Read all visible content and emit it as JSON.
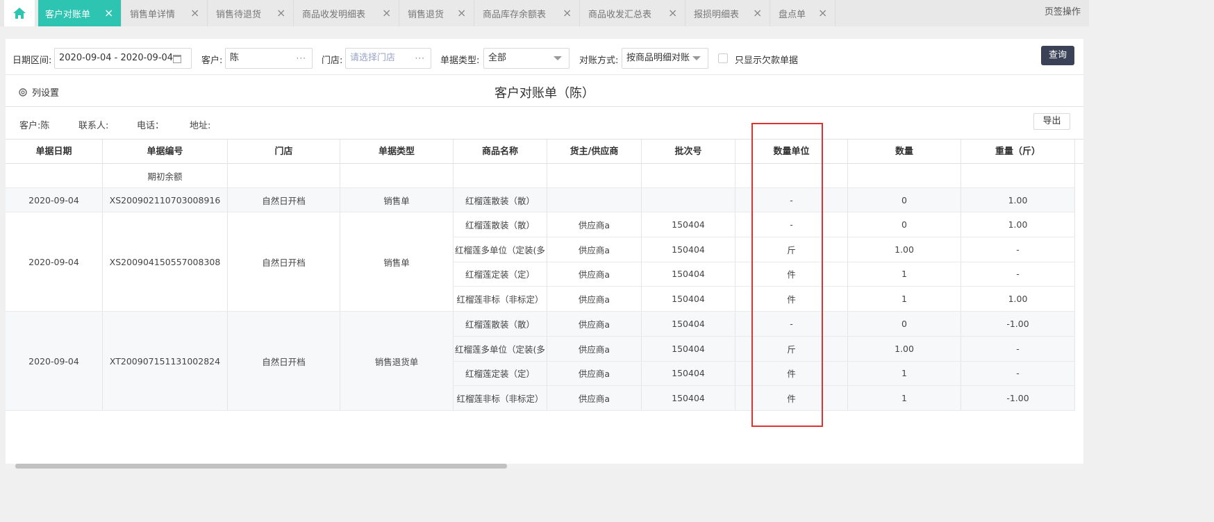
{
  "tabs": [
    {
      "label": "客户对账单",
      "active": true
    },
    {
      "label": "销售单详情"
    },
    {
      "label": "销售待退货"
    },
    {
      "label": "商品收发明细表"
    },
    {
      "label": "销售退货"
    },
    {
      "label": "商品库存余额表"
    },
    {
      "label": "商品收发汇总表"
    },
    {
      "label": "报损明细表"
    },
    {
      "label": "盘点单"
    }
  ],
  "tab_close_glyph": "×",
  "tab_menu_label": "页签操作",
  "filters": {
    "date_label": "日期区间:",
    "date_value": "2020-09-04 - 2020-09-04",
    "customer_label": "客户:",
    "customer_value": "陈",
    "store_label": "门店:",
    "store_placeholder": "请选择门店",
    "doctype_label": "单据类型:",
    "doctype_value": "全部",
    "recon_label": "对账方式:",
    "recon_value": "按商品明细对账",
    "only_debt_label": "只显示欠款单据",
    "query_label": "查询",
    "dots": "···"
  },
  "column_settings_label": "列设置",
  "report_title": "客户对账单（陈）",
  "info": {
    "customer": "客户:陈",
    "contact": "联系人:",
    "phone": "电话：",
    "address": "地址:"
  },
  "export_label": "导出",
  "table": {
    "headers": [
      "单据日期",
      "单据编号",
      "门店",
      "单据类型",
      "商品名称",
      "货主/供应商",
      "批次号",
      "",
      "数量单位",
      "数量",
      "重量（斤）"
    ],
    "opening": "期初余额",
    "groups": [
      {
        "date": "2020-09-04",
        "doc_no": "XS200902110703008916",
        "store": "自然日开档",
        "type": "销售单",
        "lines": [
          {
            "product": "红榴莲散装（散）",
            "supplier": "",
            "batch": "",
            "unit": "-",
            "qty": "0",
            "weight": "1.00"
          }
        ]
      },
      {
        "date": "2020-09-04",
        "doc_no": "XS200904150557008308",
        "store": "自然日开档",
        "type": "销售单",
        "lines": [
          {
            "product": "红榴莲散装（散）",
            "supplier": "供应商a",
            "batch": "150404",
            "unit": "-",
            "qty": "0",
            "weight": "1.00"
          },
          {
            "product": "红榴莲多单位（定装(多",
            "supplier": "供应商a",
            "batch": "150404",
            "unit": "斤",
            "qty": "1.00",
            "weight": "-"
          },
          {
            "product": "红榴莲定装（定）",
            "supplier": "供应商a",
            "batch": "150404",
            "unit": "件",
            "qty": "1",
            "weight": "-"
          },
          {
            "product": "红榴莲非标（非标定）",
            "supplier": "供应商a",
            "batch": "150404",
            "unit": "件",
            "qty": "1",
            "weight": "1.00"
          }
        ]
      },
      {
        "date": "2020-09-04",
        "doc_no": "XT200907151131002824",
        "store": "自然日开档",
        "type": "销售退货单",
        "lines": [
          {
            "product": "红榴莲散装（散）",
            "supplier": "供应商a",
            "batch": "150404",
            "unit": "-",
            "qty": "0",
            "weight": "-1.00"
          },
          {
            "product": "红榴莲多单位（定装(多",
            "supplier": "供应商a",
            "batch": "150404",
            "unit": "斤",
            "qty": "1.00",
            "weight": "-"
          },
          {
            "product": "红榴莲定装（定）",
            "supplier": "供应商a",
            "batch": "150404",
            "unit": "件",
            "qty": "1",
            "weight": "-"
          },
          {
            "product": "红榴莲非标（非标定）",
            "supplier": "供应商a",
            "batch": "150404",
            "unit": "件",
            "qty": "1",
            "weight": "-1.00"
          }
        ]
      }
    ]
  },
  "colors": {
    "accent": "#2dc4b2",
    "query_button": "#3b4157",
    "highlight_box": "#e03131"
  }
}
